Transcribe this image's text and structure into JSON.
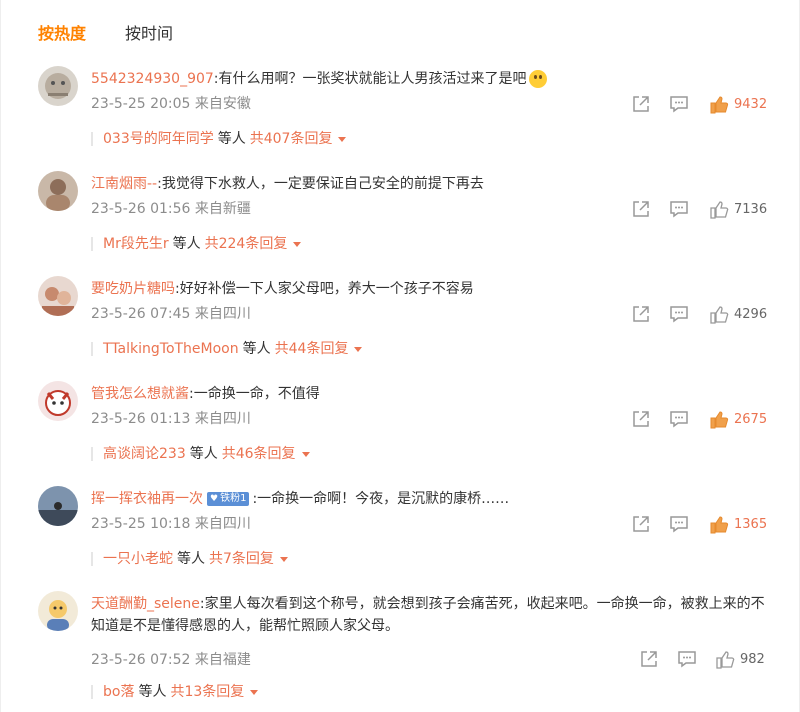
{
  "sort_tabs": {
    "hot": "按热度",
    "time": "按时间"
  },
  "colors": {
    "accent": "#ff8200",
    "link": "#eb7350",
    "meta": "#8c8c8c",
    "like_active": "#f0a04b"
  },
  "comments": [
    {
      "username": "5542324930_907",
      "text": ":有什么用啊？一张奖状就能让人男孩活过来了是吧",
      "emoji": "surprised-emoji",
      "time": "23-5-25 20:05",
      "location": "来自安徽",
      "likes": "9432",
      "liked_highlight": true,
      "reply_user": "033号的阿年同学",
      "reply_etc": "等人",
      "reply_count": "共407条回复"
    },
    {
      "username": "江南烟雨--",
      "text": ":我觉得下水救人，一定要保证自己安全的前提下再去",
      "time": "23-5-26 01:56",
      "location": "来自新疆",
      "likes": "7136",
      "liked_highlight": false,
      "reply_user": "Mr段先生r",
      "reply_etc": "等人",
      "reply_count": "共224条回复"
    },
    {
      "username": "要吃奶片糖吗",
      "text": ":好好补偿一下人家父母吧，养大一个孩子不容易",
      "time": "23-5-26 07:45",
      "location": "来自四川",
      "likes": "4296",
      "liked_highlight": false,
      "reply_user": "TTalkingToTheMoon",
      "reply_etc": "等人",
      "reply_count": "共44条回复"
    },
    {
      "username": "管我怎么想就酱",
      "text": ":一命换一命，不值得",
      "time": "23-5-26 01:13",
      "location": "来自四川",
      "likes": "2675",
      "liked_highlight": true,
      "reply_user": "高谈阔论233",
      "reply_etc": "等人",
      "reply_count": "共46条回复"
    },
    {
      "username": "挥一挥衣袖再一次",
      "badge": "铁粉1",
      "text": ":一命换一命啊！今夜，是沉默的康桥……",
      "time": "23-5-25 10:18",
      "location": "来自四川",
      "likes": "1365",
      "liked_highlight": true,
      "reply_user": "一只小老蛇",
      "reply_etc": "等人",
      "reply_count": "共7条回复"
    },
    {
      "username": "天道酬勤_selene",
      "text": ":家里人每次看到这个称号，就会想到孩子会痛苦死，收起来吧。一命换一命，被救上来的不知道是不是懂得感恩的人，能帮忙照顾人家父母。",
      "time": "23-5-26 07:52",
      "location": "来自福建",
      "likes": "982",
      "liked_highlight": false,
      "reply_user": "bo落",
      "reply_etc": "等人",
      "reply_count": "共13条回复"
    }
  ]
}
